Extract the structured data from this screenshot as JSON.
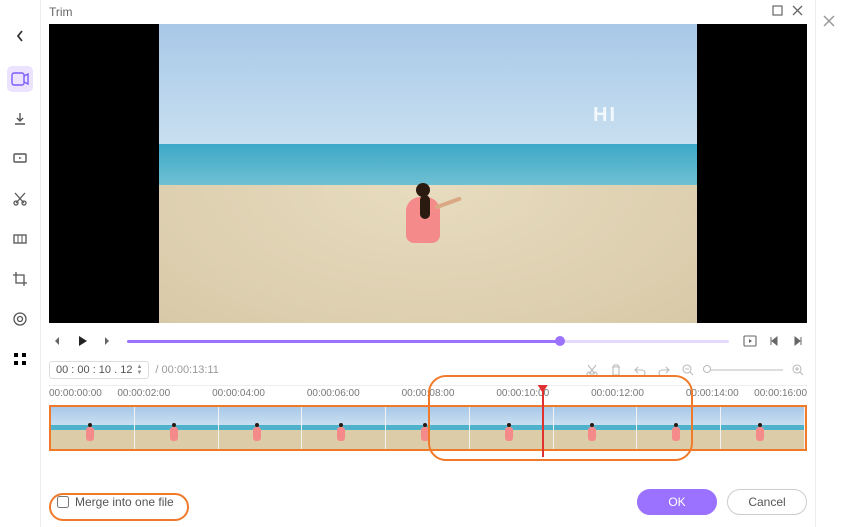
{
  "window": {
    "title": "Trim"
  },
  "overlay_text": "HI",
  "playback": {
    "progress_pct": 72
  },
  "time": {
    "current": "00 : 00 : 10 . 12",
    "total": "00:00:13:11"
  },
  "ruler": {
    "ticks": [
      "00:00:00:00",
      "00:00:02:00",
      "00:00:04:00",
      "00:00:06:00",
      "00:00:08:00",
      "00:00:10:00",
      "00:00:12:00",
      "00:00:14:00",
      "00:00:16:00"
    ]
  },
  "timeline": {
    "playhead_pct": 65,
    "selection_left_pct": 50,
    "selection_right_pct": 85,
    "thumb_count": 9
  },
  "merge_label": "Merge into one file",
  "merge_checked": false,
  "zoom_value_pct": 0,
  "buttons": {
    "ok": "OK",
    "cancel": "Cancel"
  }
}
